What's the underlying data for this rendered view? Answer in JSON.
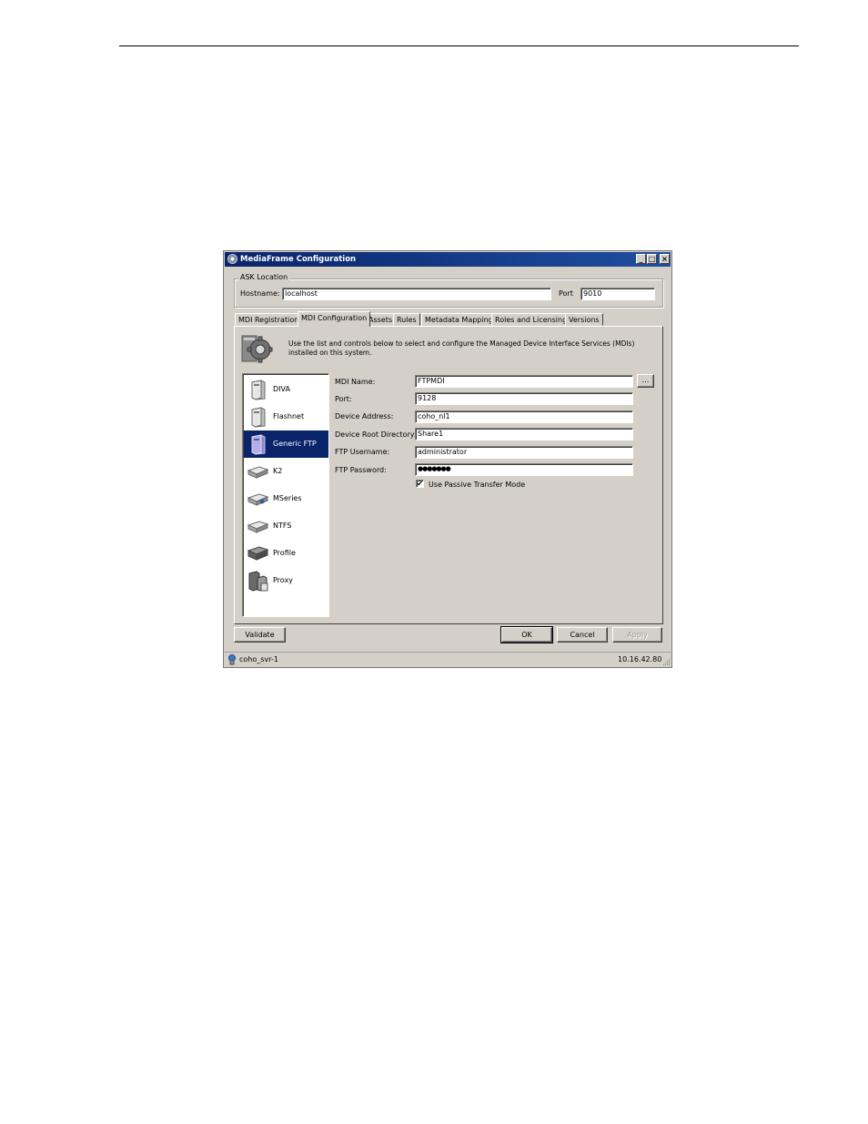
{
  "window": {
    "title": "MediaFrame Configuration",
    "controls": {
      "minimize": "_",
      "maximize": "□",
      "close": "×"
    }
  },
  "ask_location": {
    "legend": "ASK Location",
    "hostname_label": "Hostname:",
    "hostname_value": "localhost",
    "port_label": "Port",
    "port_value": "9010"
  },
  "tabs": [
    {
      "label": "MDI Registration"
    },
    {
      "label": "MDI Configuration",
      "active": true
    },
    {
      "label": "Assets"
    },
    {
      "label": "Rules"
    },
    {
      "label": "Metadata Mapping"
    },
    {
      "label": "Roles and Licensing"
    },
    {
      "label": "Versions"
    }
  ],
  "panel": {
    "intro_text": "Use the list and controls below to select and configure the Managed Device Interface Services (MDIs) installed on this system.",
    "mdi_list": [
      {
        "label": "DIVA",
        "icon": "server-tower-icon"
      },
      {
        "label": "Flashnet",
        "icon": "server-tower-icon"
      },
      {
        "label": "Generic FTP",
        "icon": "server-tower-icon",
        "selected": true
      },
      {
        "label": "K2",
        "icon": "drive-icon"
      },
      {
        "label": "MSeries",
        "icon": "drive-icon"
      },
      {
        "label": "NTFS",
        "icon": "drive-icon"
      },
      {
        "label": "Profile",
        "icon": "drive-icon"
      },
      {
        "label": "Proxy",
        "icon": "server-cluster-icon"
      }
    ],
    "fields": {
      "mdi_name_label": "MDI Name:",
      "mdi_name_value": "FTPMDI",
      "browse_label": "...",
      "port_label": "Port:",
      "port_value": "9128",
      "device_address_label": "Device Address:",
      "device_address_value": "coho_nl1",
      "device_root_label": "Device Root Directory:",
      "device_root_value": "Share1",
      "ftp_username_label": "FTP Username:",
      "ftp_username_value": "administrator",
      "ftp_password_label": "FTP Password:",
      "ftp_password_value": "●●●●●●●",
      "passive_label": "Use Passive Transfer Mode",
      "passive_checked": "✔"
    }
  },
  "buttons": {
    "validate": "Validate",
    "ok": "OK",
    "cancel": "Cancel",
    "apply": "Apply"
  },
  "status": {
    "server": "coho_svr-1",
    "ip": "10.16.42.80"
  }
}
